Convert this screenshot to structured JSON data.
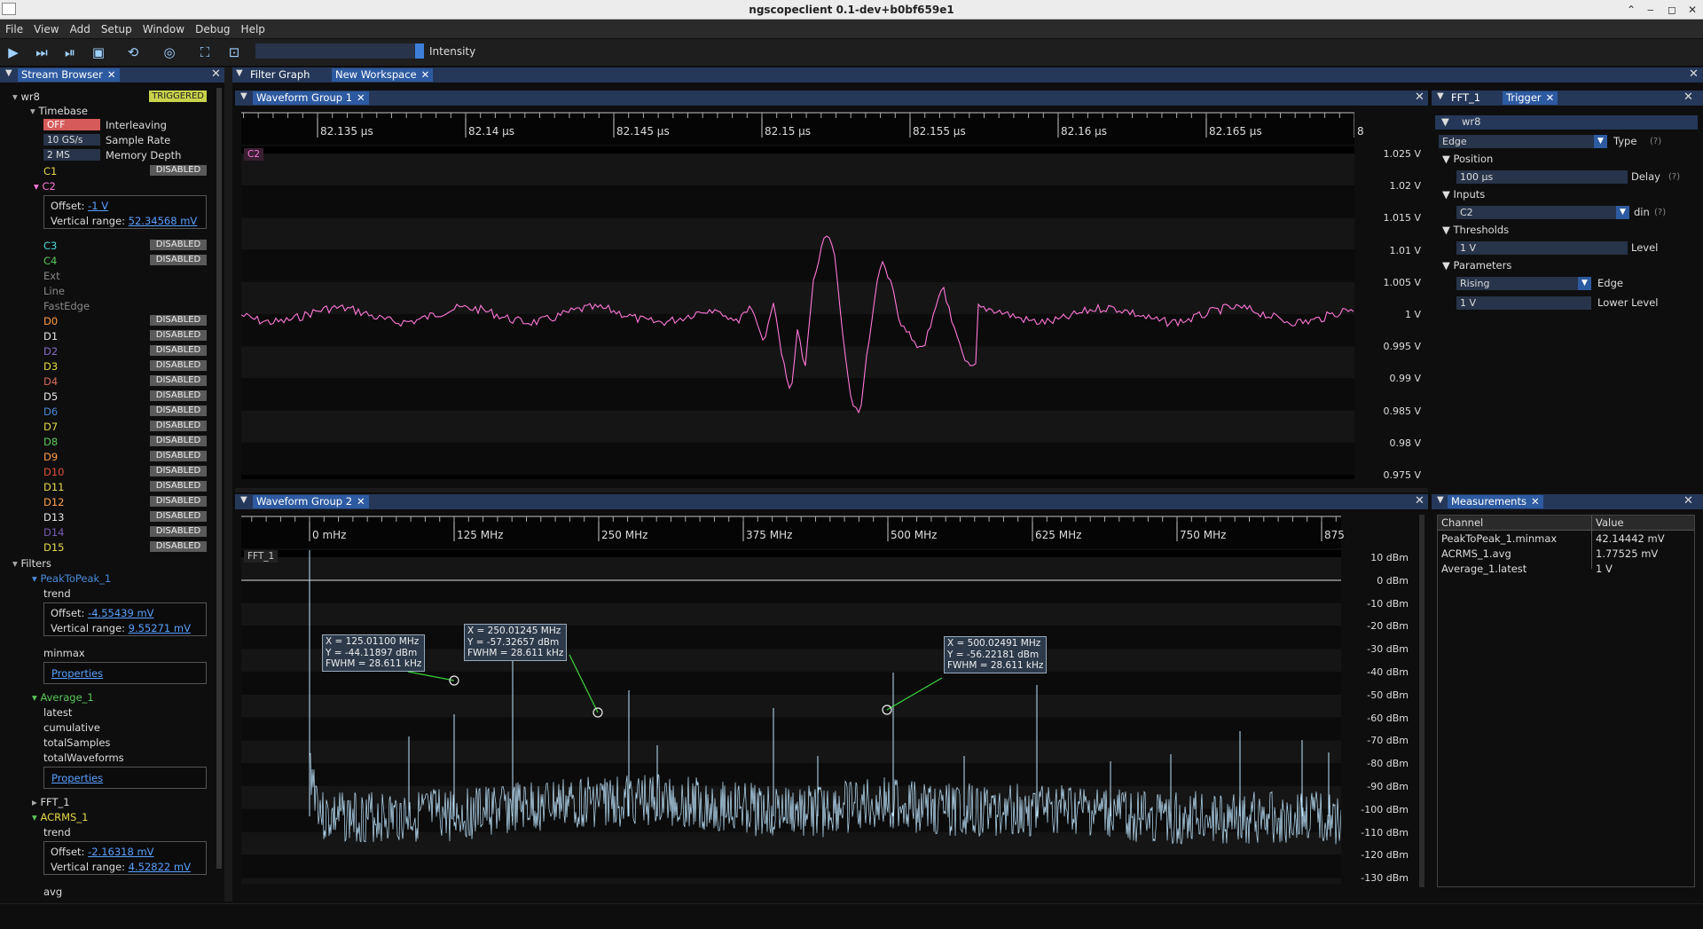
{
  "window": {
    "title": "ngscopeclient 0.1-dev+b0bf659e1",
    "controls": [
      "⌃",
      "‒",
      "◻",
      "✕"
    ]
  },
  "menu": [
    "File",
    "View",
    "Add",
    "Setup",
    "Window",
    "Debug",
    "Help"
  ],
  "toolbar": {
    "intensity_label": "Intensity"
  },
  "stream_browser": {
    "tab": "Stream Browser",
    "instrument": "wr8",
    "status": "TRIGGERED",
    "timebase_label": "Timebase",
    "interleaving": {
      "value": "OFF",
      "label": "Interleaving"
    },
    "sample_rate": {
      "value": "10 GS/s",
      "label": "Sample Rate"
    },
    "memory_depth": {
      "value": "2 MS",
      "label": "Memory Depth"
    },
    "disabled_text": "DISABLED",
    "c1": "C1",
    "c2": {
      "name": "C2",
      "offset_label": "Offset:",
      "offset": "-1 V",
      "range_label": "Vertical range:",
      "range": "52.34568 mV"
    },
    "c3": "C3",
    "c4": "C4",
    "ext": "Ext",
    "line": "Line",
    "fastedge": "FastEdge",
    "digital": [
      {
        "name": "D0",
        "color": "#ff9f4a"
      },
      {
        "name": "D1",
        "color": "#e6e6e6"
      },
      {
        "name": "D2",
        "color": "#8a6bc7"
      },
      {
        "name": "D3",
        "color": "#e6d84a"
      },
      {
        "name": "D4",
        "color": "#d86a5a"
      },
      {
        "name": "D5",
        "color": "#e6e6e6"
      },
      {
        "name": "D6",
        "color": "#4a8ad8"
      },
      {
        "name": "D7",
        "color": "#e6d84a"
      },
      {
        "name": "D8",
        "color": "#5ac85a"
      },
      {
        "name": "D9",
        "color": "#ff9f4a"
      },
      {
        "name": "D10",
        "color": "#e0503a"
      },
      {
        "name": "D11",
        "color": "#e6d84a"
      },
      {
        "name": "D12",
        "color": "#ff9f4a"
      },
      {
        "name": "D13",
        "color": "#e6e6e6"
      },
      {
        "name": "D14",
        "color": "#7a5ab0"
      },
      {
        "name": "D15",
        "color": "#e6d84a"
      }
    ],
    "filters_label": "Filters",
    "peaktopeak": {
      "name": "PeakToPeak_1",
      "trend": "trend",
      "offset_label": "Offset:",
      "offset": "-4.55439 mV",
      "range_label": "Vertical range:",
      "range": "9.55271 mV",
      "minmax": "minmax",
      "properties": "Properties"
    },
    "average": {
      "name": "Average_1",
      "latest": "latest",
      "cumulative": "cumulative",
      "totalSamples": "totalSamples",
      "totalWaveforms": "totalWaveforms",
      "properties": "Properties"
    },
    "fft": {
      "name": "FFT_1"
    },
    "acrms": {
      "name": "ACRMS_1",
      "trend": "trend",
      "offset_label": "Offset:",
      "offset": "-2.16318 mV",
      "range_label": "Vertical range:",
      "range": "4.52822 mV",
      "avg": "avg"
    }
  },
  "workspace_tabs": [
    "Filter Graph",
    "New Workspace"
  ],
  "group1": {
    "title": "Waveform Group 1",
    "channel": "C2",
    "time_labels": [
      "82.135 µs",
      "82.14 µs",
      "82.145 µs",
      "82.15 µs",
      "82.155 µs",
      "82.16 µs",
      "82.165 µs",
      "8"
    ],
    "y_labels": [
      "1.025 V",
      "1.02 V",
      "1.015 V",
      "1.01 V",
      "1.005 V",
      "1 V",
      "0.995 V",
      "0.99 V",
      "0.985 V",
      "0.98 V",
      "0.975 V"
    ]
  },
  "group2": {
    "title": "Waveform Group 2",
    "channel": "FFT_1",
    "freq_labels": [
      "0 mHz",
      "125 MHz",
      "250 MHz",
      "375 MHz",
      "500 MHz",
      "625 MHz",
      "750 MHz",
      "875"
    ],
    "y_labels": [
      "10 dBm",
      "0 dBm",
      "-10 dBm",
      "-20 dBm",
      "-30 dBm",
      "-40 dBm",
      "-50 dBm",
      "-60 dBm",
      "-70 dBm",
      "-80 dBm",
      "-90 dBm",
      "-100 dBm",
      "-110 dBm",
      "-120 dBm",
      "-130 dBm"
    ],
    "annotations": [
      {
        "x": "X = 125.01100 MHz",
        "y": "Y = -44.11897 dBm",
        "fwhm": "FWHM = 28.611 kHz"
      },
      {
        "x": "X = 250.01245 MHz",
        "y": "Y = -57.32657 dBm",
        "fwhm": "FWHM = 28.611 kHz"
      },
      {
        "x": "X = 500.02491 MHz",
        "y": "Y = -56.22181 dBm",
        "fwhm": "FWHM = 28.611 kHz"
      }
    ]
  },
  "trigger_panel": {
    "tabs": [
      "FFT_1",
      "Trigger"
    ],
    "instrument": "wr8",
    "type": {
      "value": "Edge",
      "label": "Type",
      "help": "(?)"
    },
    "position_label": "Position",
    "delay": {
      "value": "100 µs",
      "label": "Delay",
      "help": "(?)"
    },
    "inputs_label": "Inputs",
    "din": {
      "value": "C2",
      "label": "din",
      "help": "(?)"
    },
    "thresholds_label": "Thresholds",
    "level": {
      "value": "1 V",
      "label": "Level"
    },
    "parameters_label": "Parameters",
    "edge": {
      "value": "Rising",
      "label": "Edge"
    },
    "lower_level": {
      "value": "1 V",
      "label": "Lower Level"
    }
  },
  "measurements": {
    "tab": "Measurements",
    "headers": [
      "Channel",
      "Value"
    ],
    "rows": [
      {
        "channel": "PeakToPeak_1.minmax",
        "value": "42.14442 mV"
      },
      {
        "channel": "ACRMS_1.avg",
        "value": "1.77525 mV"
      },
      {
        "channel": "Average_1.latest",
        "value": "1 V"
      }
    ]
  },
  "colors": {
    "c1": "#e6d84a",
    "c2": "#ff77d8",
    "c3": "#4ad8d8",
    "c4": "#5ac85a",
    "fft": "#bfe6ff",
    "accent": "#2d5aa0"
  }
}
